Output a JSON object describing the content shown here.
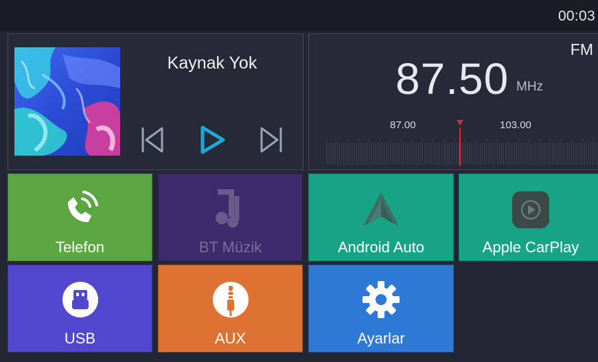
{
  "status": {
    "time": "00:03"
  },
  "media": {
    "title": "Kaynak Yok",
    "album_art_icon": "album-art-image",
    "controls": {
      "prev_icon": "skip-previous-icon",
      "play_icon": "play-icon",
      "next_icon": "skip-next-icon"
    },
    "colors": {
      "play": "#1ea8d8"
    }
  },
  "radio": {
    "band": "FM",
    "frequency": "87.50",
    "unit": "MHz",
    "scale_min": "87.00",
    "scale_max": "103.00",
    "marker_color": "#e5243b"
  },
  "tiles": [
    {
      "label": "Telefon",
      "icon": "phone-icon",
      "color": "#5ba640"
    },
    {
      "label": "BT Müzik",
      "icon": "bluetooth-music-icon",
      "color": "#3d2b6d"
    },
    {
      "label": "Android Auto",
      "icon": "android-auto-icon",
      "color": "#17a486"
    },
    {
      "label": "Apple CarPlay",
      "icon": "carplay-icon",
      "color": "#17a486"
    },
    {
      "label": "USB",
      "icon": "usb-icon",
      "color": "#5247cf"
    },
    {
      "label": "AUX",
      "icon": "aux-icon",
      "color": "#dd7233"
    },
    {
      "label": "Ayarlar",
      "icon": "gear-icon",
      "color": "#2e79d6"
    }
  ]
}
